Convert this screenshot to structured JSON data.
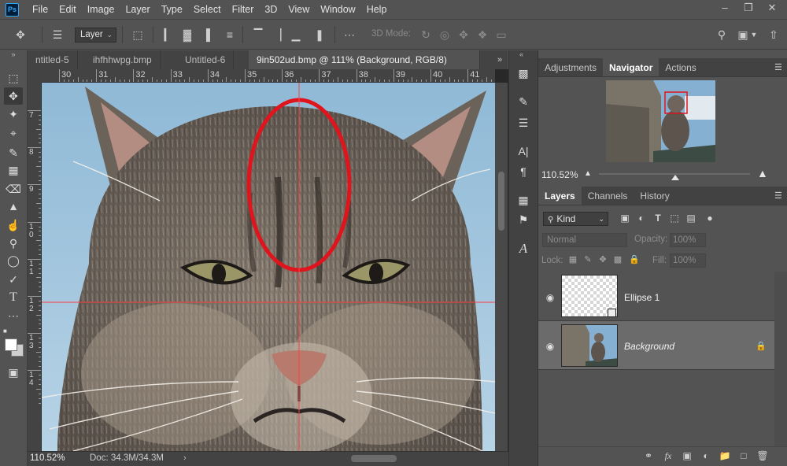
{
  "app": {
    "logo": "Ps"
  },
  "menu": [
    "File",
    "Edit",
    "Image",
    "Layer",
    "Type",
    "Select",
    "Filter",
    "3D",
    "View",
    "Window",
    "Help"
  ],
  "window_controls": [
    "minimize-icon",
    "restore-icon",
    "close-icon"
  ],
  "options_bar": {
    "auto_select_target": "Layer",
    "mode_3d_label": "3D Mode:"
  },
  "tabs": [
    {
      "label": "ntitled-5",
      "active": false
    },
    {
      "label": "ihfhhwpg.bmp",
      "active": false
    },
    {
      "label": "Untitled-6",
      "active": false
    },
    {
      "label": "9in502ud.bmp @ 111% (Background, RGB/8) *",
      "active": true
    }
  ],
  "ruler": {
    "top": [
      "30",
      "31",
      "32",
      "33",
      "34",
      "35",
      "36",
      "37",
      "38",
      "39",
      "40",
      "41"
    ],
    "left": [
      "7",
      "8",
      "9",
      "1\n0",
      "1\n1",
      "1\n2",
      "1\n3",
      "1\n4"
    ]
  },
  "status": {
    "zoom": "110.52%",
    "doc": "Doc: 34.3M/34.3M"
  },
  "panels": {
    "top_tabs": [
      "Adjustments",
      "Navigator",
      "Actions"
    ],
    "active_top_tab": "Navigator",
    "navigator_zoom": "110.52%",
    "layers_tabs": [
      "Layers",
      "Channels",
      "History"
    ],
    "filter_kind": "Kind",
    "blend_mode": "Normal",
    "opacity_label": "Opacity:",
    "opacity_value": "100%",
    "lock_label": "Lock:",
    "fill_label": "Fill:",
    "fill_value": "100%",
    "layers": [
      {
        "name": "Ellipse 1",
        "visible": true,
        "selected": false
      },
      {
        "name": "Background",
        "visible": true,
        "selected": true,
        "locked": true
      }
    ]
  },
  "colors": {
    "guide": "#ff4040",
    "ellipse": "#e0141c",
    "accent": "#31a8ff"
  }
}
